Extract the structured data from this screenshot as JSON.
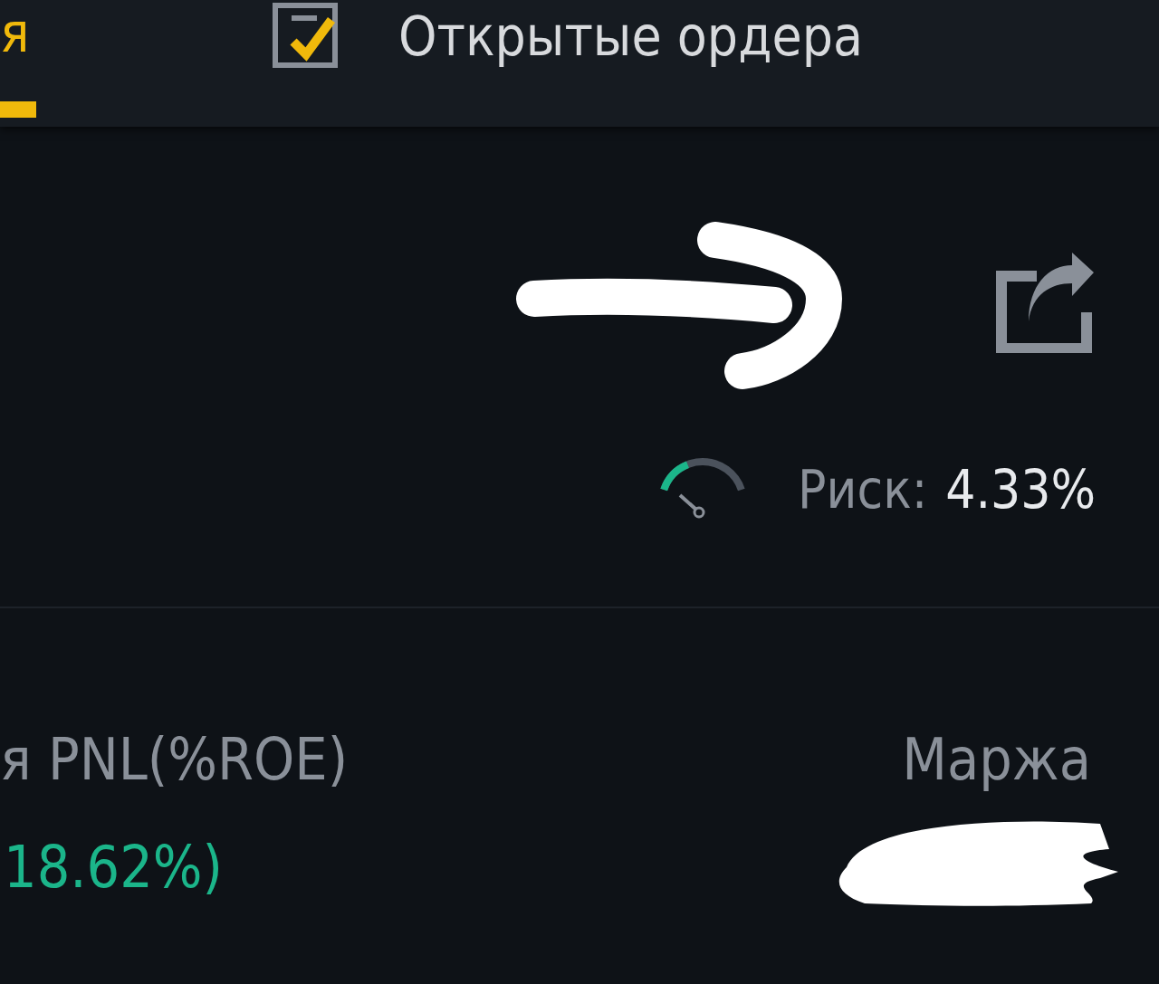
{
  "tabs": [
    {
      "label": "я",
      "selected": true
    },
    {
      "label": "Открытые ордера",
      "selected": false
    }
  ],
  "risk": {
    "label": "Риск:",
    "value": "4.33%"
  },
  "columns": [
    {
      "label": "я PNL(%ROE)",
      "value": "18.62%)",
      "kind": "pnl"
    },
    {
      "label": "Маржа",
      "kind": "margin"
    }
  ]
}
